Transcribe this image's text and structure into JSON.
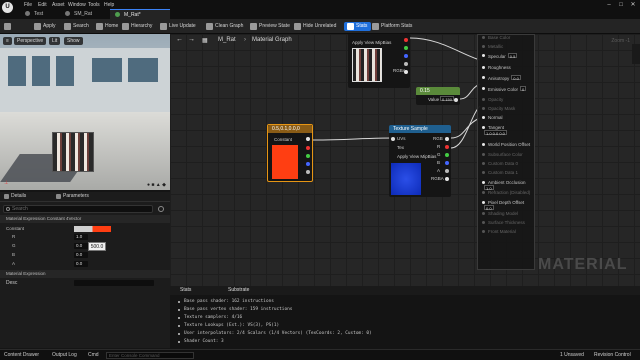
{
  "menu": {
    "items": [
      "File",
      "Edit",
      "Asset",
      "Window",
      "Tools",
      "Help"
    ]
  },
  "tabs": [
    {
      "label": "Test",
      "active": false
    },
    {
      "label": "SM_Rat",
      "active": false
    },
    {
      "label": "M_Rat*",
      "active": true
    }
  ],
  "toolbar": {
    "save": "",
    "apply": "Apply",
    "search": "Search",
    "home": "Home",
    "hierarchy": "Hierarchy",
    "live_update": "Live Update",
    "clean_graph": "Clean Graph",
    "preview_state": "Preview State",
    "hide_unrelated": "Hide Unrelated",
    "stats": "Stats",
    "platform_stats": "Platform Stats"
  },
  "viewport": {
    "perspective": "Perspective",
    "lit": "Lit",
    "show": "Show"
  },
  "left_tabs": {
    "details": "Details",
    "parameters": "Parameters"
  },
  "details": {
    "search_placeholder": "Search",
    "section_title": "Material Expression Constant 4Vector",
    "constant_label": "Constant",
    "channels": [
      {
        "label": "R",
        "value": "1.0"
      },
      {
        "label": "G",
        "value": "0.0"
      },
      {
        "label": "B",
        "value": "0.0"
      },
      {
        "label": "A",
        "value": "0.0"
      }
    ],
    "tooltip": "500.0",
    "section2_title": "Material Expression",
    "desc_label": "Desc"
  },
  "graph": {
    "title": "M_Rat",
    "subtitle": "Material Graph",
    "zoom": "Zoom -1",
    "watermark": "MATERIAL",
    "texture_top": {
      "apply_view_mip": "Apply View MipBias",
      "rgba": "RGBA"
    },
    "scalar": {
      "title": "0.15",
      "value_label": "Value",
      "value": "0.150"
    },
    "constant": {
      "title": "0.5,0.1,0.0,0",
      "output": "Constant"
    },
    "texture_sample": {
      "title": "Texture Sample",
      "uvs": "UVs",
      "tex": "Tex",
      "apply": "Apply View MipBias",
      "rgb": "RGB",
      "r": "R",
      "g": "G",
      "b": "B",
      "a": "A",
      "rgba": "RGBA"
    },
    "main_rows": [
      {
        "label": "Base Color",
        "dim": true
      },
      {
        "label": "Metallic",
        "dim": true
      },
      {
        "label": "Specular",
        "dim": false,
        "box": "0.5"
      },
      {
        "label": "Roughness",
        "dim": false
      },
      {
        "label": "Anisotropy",
        "dim": false,
        "box": "0.0"
      },
      {
        "label": "Emissive Color",
        "dim": false,
        "box": "0"
      },
      {
        "label": "Opacity",
        "dim": true
      },
      {
        "label": "Opacity Mask",
        "dim": true
      },
      {
        "label": "Normal",
        "dim": false
      },
      {
        "label": "Tangent",
        "dim": false,
        "box": "1.0 0.0 0.0"
      },
      {
        "label": "World Position Offset",
        "dim": false
      },
      {
        "label": "Subsurface Color",
        "dim": true
      },
      {
        "label": "Custom Data 0",
        "dim": true
      },
      {
        "label": "Custom Data 1",
        "dim": true
      },
      {
        "label": "Ambient Occlusion",
        "dim": false,
        "box": "1.0"
      },
      {
        "label": "Refraction (Disabled)",
        "dim": true
      },
      {
        "label": "Pixel Depth Offset",
        "dim": false,
        "box": "0.0"
      },
      {
        "label": "Shading Model",
        "dim": true
      },
      {
        "label": "Surface Thickness",
        "dim": true
      },
      {
        "label": "Front Material",
        "dim": true
      }
    ]
  },
  "stats_tabs": {
    "stats": "Stats",
    "substrate": "Substrate"
  },
  "stats_lines": [
    "Base pass shader: 162 instructions",
    "Base pass vertex shader: 159 instructions",
    "Texture samplers: 4/16",
    "Texture Lookups (Est.): VS(3), PS(1)",
    "User interpolators: 2/4 Scalars (1/4 Vectors) (TexCoords: 2, Custom: 0)",
    "Shader Count: 3"
  ],
  "statusbar": {
    "content_drawer": "Content Drawer",
    "output_log": "Output Log",
    "cmd": "Cmd",
    "cmd_placeholder": "Enter Console Command",
    "unsaved": "1 Unsaved",
    "revision_control": "Revision Control"
  },
  "colors": {
    "accent": "#1f6fdc",
    "constant_red": "#ff3e12",
    "selection": "#e69514",
    "scalar_green": "#5a8a3a"
  },
  "icons": [
    "save-icon",
    "apply-icon",
    "search-icon",
    "home-icon",
    "hierarchy-icon",
    "live-update-icon",
    "clean-graph-icon",
    "preview-icon",
    "hide-icon",
    "stats-icon",
    "platform-stats-icon",
    "gear-icon"
  ]
}
